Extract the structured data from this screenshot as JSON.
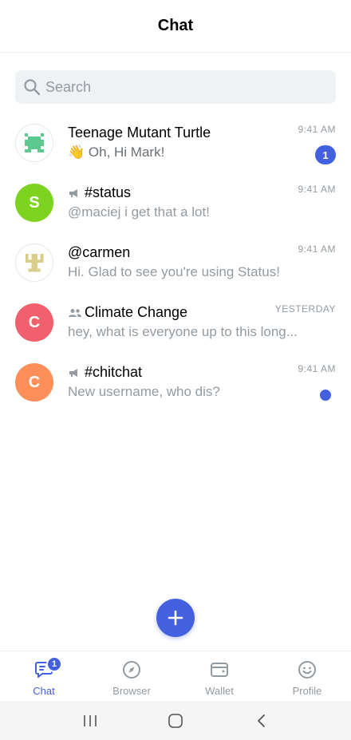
{
  "header": {
    "title": "Chat"
  },
  "search": {
    "placeholder": "Search"
  },
  "chats": [
    {
      "title": "Teenage Mutant Turtle",
      "preview": "👋 Oh, Hi Mark!",
      "time": "9:41 AM",
      "unread": "1",
      "avatar_type": "identicon",
      "avatar_color": "#5cc98e"
    },
    {
      "title": "#status",
      "preview": "@maciej i get that a lot!",
      "time": "9:41 AM",
      "avatar_letter": "S",
      "avatar_color": "#7ed321",
      "type_icon": "megaphone-icon"
    },
    {
      "title": "@carmen",
      "preview": "Hi. Glad to see you're using Status!",
      "time": "9:41 AM",
      "avatar_type": "identicon",
      "avatar_color": "#d9cd8a"
    },
    {
      "title": "Climate Change",
      "preview": "hey, what is everyone up to this long...",
      "time": "YESTERDAY",
      "avatar_letter": "C",
      "avatar_color": "#f0616d",
      "type_icon": "group-icon"
    },
    {
      "title": "#chitchat",
      "preview": "New username, who dis?",
      "time": "9:41 AM",
      "avatar_letter": "C",
      "avatar_color": "#fe8f59",
      "type_icon": "megaphone-icon",
      "unread_dot": true
    }
  ],
  "tabs": [
    {
      "label": "Chat",
      "icon": "chat-icon",
      "active": true,
      "badge": "1"
    },
    {
      "label": "Browser",
      "icon": "compass-icon"
    },
    {
      "label": "Wallet",
      "icon": "wallet-icon"
    },
    {
      "label": "Profile",
      "icon": "smiley-icon"
    }
  ],
  "colors": {
    "accent": "#4360df",
    "muted": "#939ba1"
  }
}
